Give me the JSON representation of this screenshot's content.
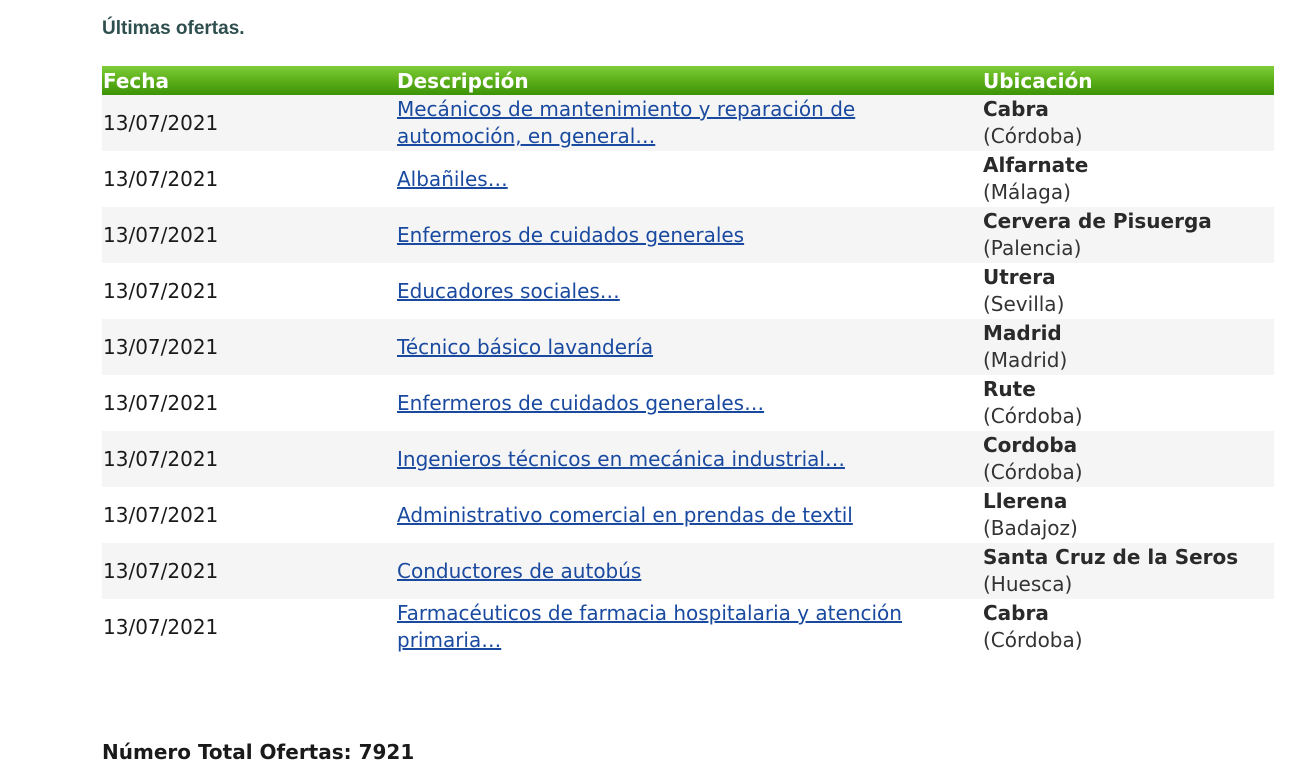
{
  "page": {
    "title": "Últimas ofertas."
  },
  "table": {
    "headers": {
      "date": "Fecha",
      "description": "Descripción",
      "location": "Ubicación"
    },
    "rows": [
      {
        "date": "13/07/2021",
        "description": "Mecánicos de mantenimiento y reparación de automoción, en general…",
        "city": "Cabra",
        "province": "(Córdoba)"
      },
      {
        "date": "13/07/2021",
        "description": "Albañiles…",
        "city": "Alfarnate",
        "province": "(Málaga)"
      },
      {
        "date": "13/07/2021",
        "description": "Enfermeros de cuidados generales",
        "city": "Cervera de Pisuerga",
        "province": "(Palencia)"
      },
      {
        "date": "13/07/2021",
        "description": "Educadores sociales…",
        "city": "Utrera",
        "province": "(Sevilla)"
      },
      {
        "date": "13/07/2021",
        "description": "Técnico básico lavandería",
        "city": "Madrid",
        "province": "(Madrid)"
      },
      {
        "date": "13/07/2021",
        "description": "Enfermeros de cuidados generales…",
        "city": "Rute",
        "province": "(Córdoba)"
      },
      {
        "date": "13/07/2021",
        "description": "Ingenieros técnicos en mecánica industrial…",
        "city": "Cordoba",
        "province": "(Córdoba)"
      },
      {
        "date": "13/07/2021",
        "description": "Administrativo comercial en prendas de textil",
        "city": "Llerena",
        "province": "(Badajoz)"
      },
      {
        "date": "13/07/2021",
        "description": "Conductores de autobús",
        "city": "Santa Cruz de la Seros",
        "province": "(Huesca)"
      },
      {
        "date": "13/07/2021",
        "description": "Farmacéuticos de farmacia hospitalaria y atención primaria…",
        "city": "Cabra",
        "province": "(Córdoba)"
      }
    ]
  },
  "footer": {
    "total_label": "Número Total Ofertas: 7921"
  },
  "colors": {
    "header_green": "#5fb21c",
    "link_blue": "#1a4aa0",
    "title_color": "#2f4f4f"
  }
}
